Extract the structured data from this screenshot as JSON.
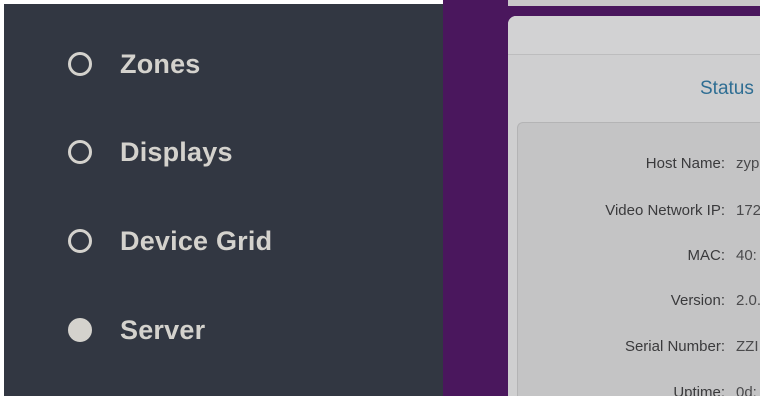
{
  "sidebar": {
    "items": [
      {
        "label": "Zones",
        "selected": false
      },
      {
        "label": "Displays",
        "selected": false
      },
      {
        "label": "Device Grid",
        "selected": false
      },
      {
        "label": "Server",
        "selected": true
      }
    ]
  },
  "status_panel": {
    "title": "Status",
    "rows": [
      {
        "label": "Host Name:",
        "value": "zyp"
      },
      {
        "label": "Video Network IP:",
        "value": "172"
      },
      {
        "label": "MAC:",
        "value": "40:"
      },
      {
        "label": "Version:",
        "value": "2.0."
      },
      {
        "label": "Serial Number:",
        "value": "ZZI"
      },
      {
        "label": "Uptime:",
        "value": "0d:"
      }
    ]
  },
  "colors": {
    "sidebar_bg": "#323742",
    "nav_text": "#d4d2cd",
    "accent_purple": "#4a175d",
    "panel_bg": "#cfcfd0",
    "status_title": "#2f6e93"
  }
}
